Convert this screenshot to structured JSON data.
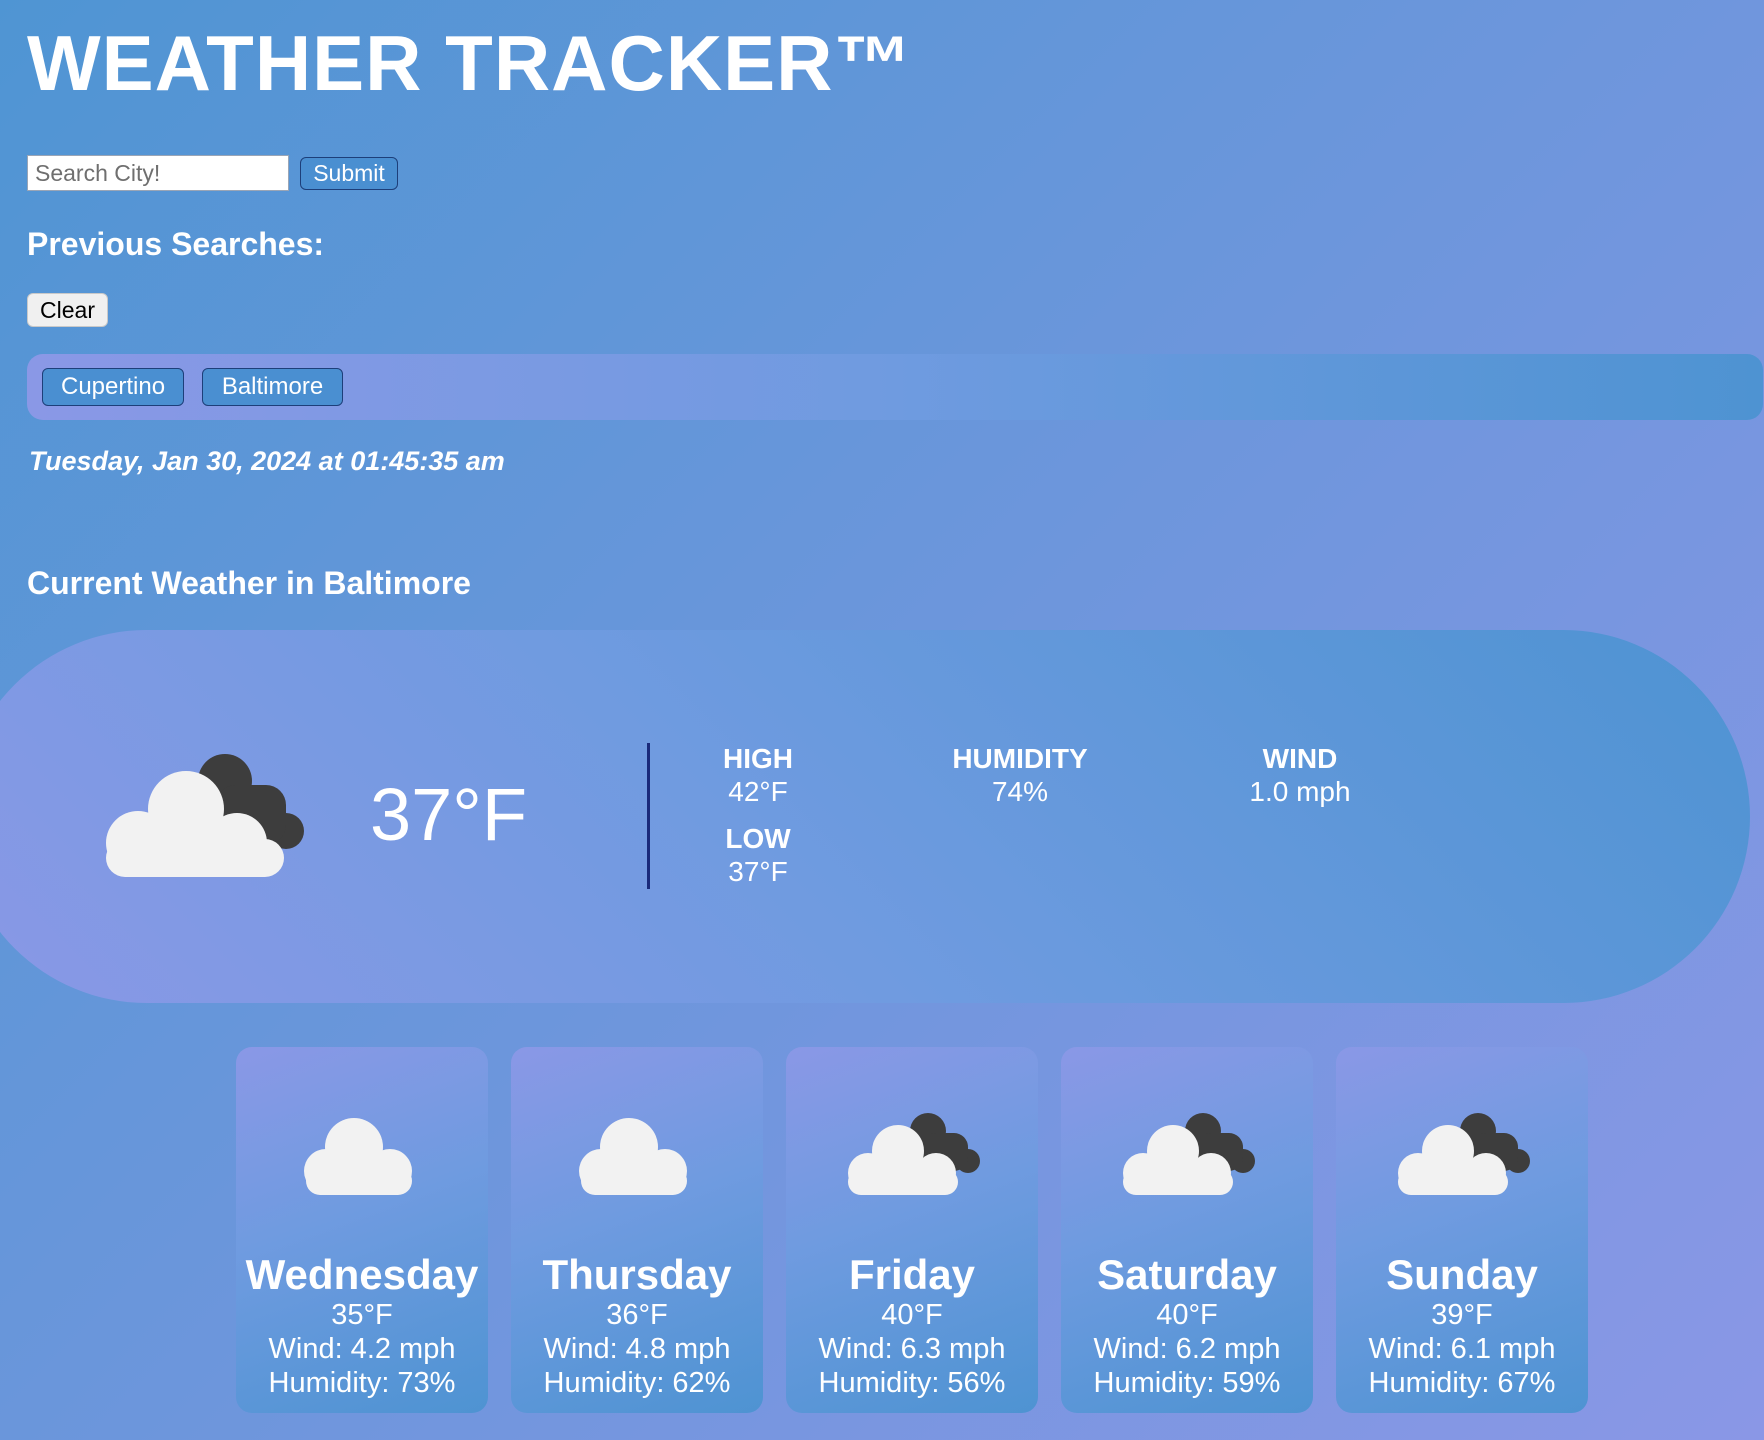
{
  "app": {
    "title": "WEATHER TRACKER™"
  },
  "search": {
    "placeholder": "Search City!",
    "value": "",
    "submit_label": "Submit"
  },
  "history": {
    "heading": "Previous Searches:",
    "clear_label": "Clear",
    "cities": [
      "Cupertino",
      "Baltimore"
    ]
  },
  "datetime": "Tuesday, Jan 30, 2024 at 01:45:35 am",
  "current": {
    "heading": "Current Weather in Baltimore",
    "icon": "cloudy-icon",
    "temp": "37°F",
    "high_label": "HIGH",
    "high": "42°F",
    "low_label": "LOW",
    "low": "37°F",
    "humidity_label": "HUMIDITY",
    "humidity": "74%",
    "wind_label": "WIND",
    "wind": "1.0 mph"
  },
  "forecast": [
    {
      "day": "Wednesday",
      "temp": "35°F",
      "wind": "Wind: 4.2 mph",
      "humidity": "Humidity: 73%",
      "icon": "cloud-icon"
    },
    {
      "day": "Thursday",
      "temp": "36°F",
      "wind": "Wind: 4.8 mph",
      "humidity": "Humidity: 62%",
      "icon": "cloud-icon"
    },
    {
      "day": "Friday",
      "temp": "40°F",
      "wind": "Wind: 6.3 mph",
      "humidity": "Humidity: 56%",
      "icon": "cloudy-icon"
    },
    {
      "day": "Saturday",
      "temp": "40°F",
      "wind": "Wind: 6.2 mph",
      "humidity": "Humidity: 59%",
      "icon": "cloudy-icon"
    },
    {
      "day": "Sunday",
      "temp": "39°F",
      "wind": "Wind: 6.1 mph",
      "humidity": "Humidity: 67%",
      "icon": "cloudy-icon"
    }
  ]
}
